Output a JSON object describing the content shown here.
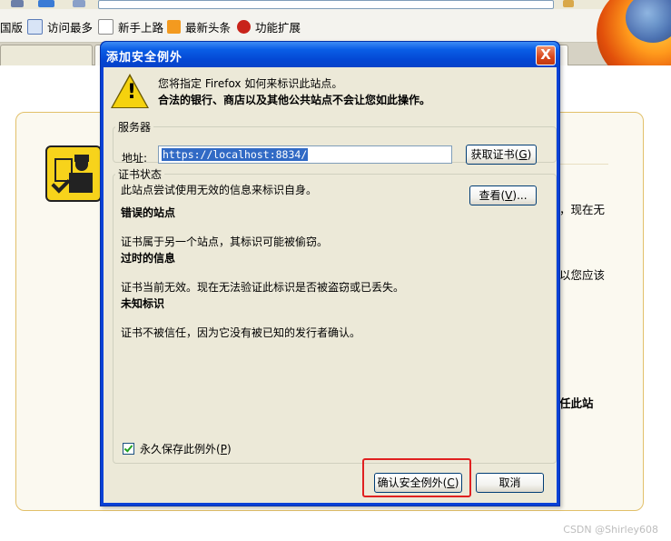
{
  "browser": {
    "bookmarks": [
      {
        "label": "国版",
        "icon": "folder-icon"
      },
      {
        "label": "访问最多",
        "icon": "clock-icon"
      },
      {
        "label": "新手上路",
        "icon": "page-icon"
      },
      {
        "label": "最新头条",
        "icon": "rss-icon"
      },
      {
        "label": "功能扩展",
        "icon": "addon-icon"
      }
    ],
    "bg_text": {
      "line1": "，现在无",
      "line2": "以您应该",
      "line3": "任此站"
    },
    "watermark": "CSDN @Shirley608"
  },
  "dialog": {
    "title": "添加安全例外",
    "close_label": "X",
    "intro_line1": "您将指定 Firefox 如何来标识此站点。",
    "intro_line2": "合法的银行、商店以及其他公共站点不会让您如此操作。",
    "server": {
      "legend": "服务器",
      "address_label": "地址:",
      "address_value": "https://localhost:8834/",
      "get_cert_label": "获取证书",
      "get_cert_key": "G"
    },
    "cert_status": {
      "legend": "证书状态",
      "summary": "此站点尝试使用无效的信息来标识自身。",
      "view_label": "查看",
      "view_key": "V",
      "wrong_site_title": "错误的站点",
      "wrong_site_text": "证书属于另一个站点，其标识可能被偷窃。",
      "expired_title": "过时的信息",
      "expired_text": "证书当前无效。现在无法验证此标识是否被盗窃或已丢失。",
      "unknown_title": "未知标识",
      "unknown_text": "证书不被信任，因为它没有被已知的发行者确认。"
    },
    "permanent_label": "永久保存此例外",
    "permanent_key": "P",
    "permanent_checked": true,
    "confirm_label": "确认安全例外",
    "confirm_key": "C",
    "cancel_label": "取消"
  },
  "colors": {
    "titlebar": "#0a5ee6",
    "highlight_box": "#e02020",
    "dialog_bg": "#ece9d8"
  }
}
